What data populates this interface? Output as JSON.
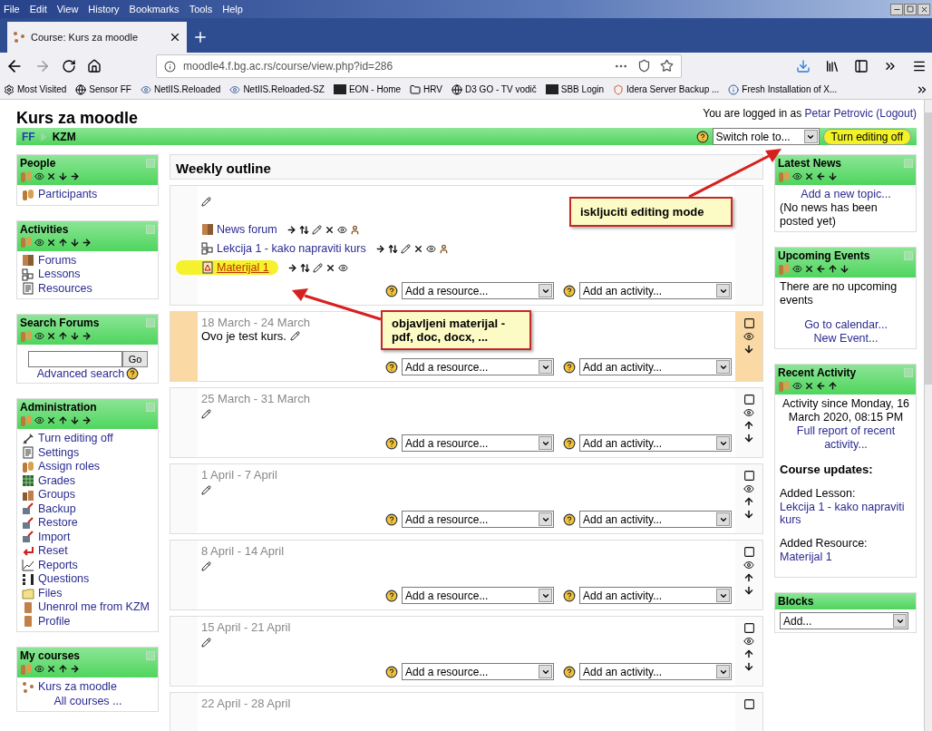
{
  "browser": {
    "menu": [
      "File",
      "Edit",
      "View",
      "History",
      "Bookmarks",
      "Tools",
      "Help"
    ],
    "tabs": [
      {
        "title": "Course: Kurs za moodle",
        "selected": true
      }
    ],
    "url": "moodle4.f.bg.ac.rs/course/view.php?id=286",
    "bookmarks": [
      {
        "label": "Most Visited",
        "kind": "gear"
      },
      {
        "label": "Sensor FF",
        "kind": "globe"
      },
      {
        "label": "NetIIS.Reloaded",
        "kind": "eye"
      },
      {
        "label": "NetIIS.Reloaded-SZ",
        "kind": "eye"
      },
      {
        "label": "EON - Home",
        "kind": "box"
      },
      {
        "label": "HRV",
        "kind": "folder"
      },
      {
        "label": "D3 GO - TV vodič",
        "kind": "globe"
      },
      {
        "label": "SBB Login",
        "kind": "box"
      },
      {
        "label": "Idera Server Backup ...",
        "kind": "shield"
      },
      {
        "label": "Fresh Installation of X...",
        "kind": "info"
      }
    ]
  },
  "page": {
    "title": "Kurs za moodle",
    "login": {
      "text": "You are logged in as",
      "user": "Petar Petrovic",
      "logout": "(Logout)"
    },
    "breadcrumb": [
      "FF",
      "KZM"
    ],
    "role_select": "Switch role to...",
    "edit_button": "Turn editing off"
  },
  "left_blocks": [
    {
      "title": "People",
      "collapsible": true,
      "controls": [
        {
          "kind": "role"
        },
        {
          "kind": "hide"
        },
        {
          "kind": "delete"
        },
        {
          "kind": "down"
        },
        {
          "kind": "right"
        }
      ],
      "lines": [
        {
          "kind": "role",
          "text": "Participants"
        }
      ]
    },
    {
      "title": "Activities",
      "collapsible": true,
      "controls": [
        {
          "kind": "role"
        },
        {
          "kind": "hide"
        },
        {
          "kind": "delete"
        },
        {
          "kind": "up"
        },
        {
          "kind": "down"
        },
        {
          "kind": "right"
        }
      ],
      "lines": [
        {
          "kind": "forum",
          "text": "Forums"
        },
        {
          "kind": "lesson",
          "text": "Lessons"
        },
        {
          "kind": "resource",
          "text": "Resources"
        }
      ]
    },
    {
      "title": "Search Forums",
      "collapsible": true,
      "controls": [
        {
          "kind": "role"
        },
        {
          "kind": "hide"
        },
        {
          "kind": "delete"
        },
        {
          "kind": "up"
        },
        {
          "kind": "down"
        },
        {
          "kind": "right"
        }
      ],
      "lines": [
        {
          "kind": "search",
          "text": "Go"
        },
        {
          "kind": "help-link",
          "text": "Advanced search"
        }
      ]
    },
    {
      "title": "Administration",
      "collapsible": true,
      "controls": [
        {
          "kind": "role"
        },
        {
          "kind": "hide"
        },
        {
          "kind": "delete"
        },
        {
          "kind": "up"
        },
        {
          "kind": "down"
        },
        {
          "kind": "right"
        }
      ],
      "lines": [
        {
          "kind": "edit",
          "text": "Turn editing off"
        },
        {
          "kind": "resource",
          "text": "Settings"
        },
        {
          "kind": "role",
          "text": "Assign roles"
        },
        {
          "kind": "grades",
          "text": "Grades"
        },
        {
          "kind": "groups",
          "text": "Groups"
        },
        {
          "kind": "backup",
          "text": "Backup"
        },
        {
          "kind": "backup",
          "text": "Restore"
        },
        {
          "kind": "backup",
          "text": "Import"
        },
        {
          "kind": "reset",
          "text": "Reset"
        },
        {
          "kind": "reports",
          "text": "Reports"
        },
        {
          "kind": "questions",
          "text": "Questions"
        },
        {
          "kind": "files",
          "text": "Files"
        },
        {
          "kind": "person",
          "text": "Unenrol me from KZM"
        },
        {
          "kind": "person",
          "text": "Profile"
        }
      ]
    },
    {
      "title": "My courses",
      "collapsible": true,
      "controls": [
        {
          "kind": "role"
        },
        {
          "kind": "hide"
        },
        {
          "kind": "delete"
        },
        {
          "kind": "up"
        },
        {
          "kind": "right"
        }
      ],
      "lines": [
        {
          "kind": "course",
          "text": "Kurs za moodle"
        },
        {
          "kind": "center-link",
          "text": "All courses ..."
        }
      ]
    }
  ],
  "outline": {
    "title": "Weekly outline",
    "sections": [
      {
        "current": false,
        "edit": true,
        "items": [
          {
            "kind": "forum",
            "name": "News forum",
            "marked": false,
            "controls": [
              {
                "kind": "move"
              },
              {
                "kind": "updown"
              },
              {
                "kind": "edit"
              },
              {
                "kind": "delete"
              },
              {
                "kind": "hide"
              },
              {
                "kind": "group"
              }
            ]
          },
          {
            "kind": "lesson",
            "name": "Lekcija 1 - kako napraviti kurs",
            "marked": false,
            "controls": [
              {
                "kind": "move"
              },
              {
                "kind": "updown"
              },
              {
                "kind": "edit"
              },
              {
                "kind": "delete"
              },
              {
                "kind": "hide"
              },
              {
                "kind": "group"
              }
            ]
          },
          {
            "kind": "pdf",
            "name": "Materijal 1",
            "marked": true,
            "controls": [
              {
                "kind": "move"
              },
              {
                "kind": "updown"
              },
              {
                "kind": "edit"
              },
              {
                "kind": "delete"
              },
              {
                "kind": "hide"
              }
            ]
          }
        ],
        "selects": [
          "Add a resource...",
          "Add an activity..."
        ]
      },
      {
        "dates": "18 March - 24 March",
        "summary": "Ovo je test kurs.",
        "current": true,
        "edit": true,
        "selects": [
          "Add a resource...",
          "Add an activity..."
        ],
        "controls": [
          {
            "kind": "highlight"
          },
          {
            "kind": "hide"
          },
          {
            "kind": "down"
          }
        ]
      },
      {
        "dates": "25 March - 31 March",
        "current": false,
        "edit": true,
        "selects": [
          "Add a resource...",
          "Add an activity..."
        ],
        "controls": [
          {
            "kind": "highlight"
          },
          {
            "kind": "hide"
          },
          {
            "kind": "up"
          },
          {
            "kind": "down"
          }
        ]
      },
      {
        "dates": "1 April - 7 April",
        "current": false,
        "edit": true,
        "selects": [
          "Add a resource...",
          "Add an activity..."
        ],
        "controls": [
          {
            "kind": "highlight"
          },
          {
            "kind": "hide"
          },
          {
            "kind": "up"
          },
          {
            "kind": "down"
          }
        ]
      },
      {
        "dates": "8 April - 14 April",
        "current": false,
        "edit": true,
        "selects": [
          "Add a resource...",
          "Add an activity..."
        ],
        "controls": [
          {
            "kind": "highlight"
          },
          {
            "kind": "hide"
          },
          {
            "kind": "up"
          },
          {
            "kind": "down"
          }
        ]
      },
      {
        "dates": "15 April - 21 April",
        "current": false,
        "edit": true,
        "selects": [
          "Add a resource...",
          "Add an activity..."
        ],
        "controls": [
          {
            "kind": "highlight"
          },
          {
            "kind": "hide"
          },
          {
            "kind": "up"
          },
          {
            "kind": "down"
          }
        ]
      },
      {
        "dates": "22 April - 28 April",
        "current": false,
        "edit": false,
        "controls": [
          {
            "kind": "highlight"
          }
        ]
      }
    ]
  },
  "right_blocks": [
    {
      "title": "Latest News",
      "collapsible": true,
      "controls": [
        {
          "kind": "role"
        },
        {
          "kind": "hide"
        },
        {
          "kind": "delete"
        },
        {
          "kind": "left"
        },
        {
          "kind": "down"
        }
      ],
      "lines": [
        {
          "kind": "center-link",
          "text": "Add a new topic..."
        },
        {
          "kind": "text",
          "text": "(No news has been posted yet)"
        }
      ]
    },
    {
      "title": "Upcoming Events",
      "collapsible": true,
      "controls": [
        {
          "kind": "role"
        },
        {
          "kind": "hide"
        },
        {
          "kind": "delete"
        },
        {
          "kind": "left"
        },
        {
          "kind": "up"
        },
        {
          "kind": "down"
        }
      ],
      "lines": [
        {
          "kind": "text",
          "text": "There are no upcoming events"
        },
        {
          "kind": "spacer"
        },
        {
          "kind": "center-link",
          "text": "Go to calendar..."
        },
        {
          "kind": "center-link",
          "text": "New Event..."
        }
      ]
    },
    {
      "title": "Recent Activity",
      "collapsible": true,
      "controls": [
        {
          "kind": "role"
        },
        {
          "kind": "hide"
        },
        {
          "kind": "delete"
        },
        {
          "kind": "left"
        },
        {
          "kind": "up"
        }
      ],
      "lines": [
        {
          "kind": "center-text",
          "text": "Activity since Monday, 16 March 2020, 08:15 PM"
        },
        {
          "kind": "center-link",
          "text": "Full report of recent activity..."
        },
        {
          "kind": "spacer"
        },
        {
          "kind": "heading",
          "text": "Course updates:"
        },
        {
          "kind": "spacer"
        },
        {
          "kind": "text",
          "text": "Added Lesson:"
        },
        {
          "kind": "link",
          "text": "Lekcija 1 - kako napraviti kurs"
        },
        {
          "kind": "spacer"
        },
        {
          "kind": "text",
          "text": "Added Resource:"
        },
        {
          "kind": "link",
          "text": "Materijal 1"
        },
        {
          "kind": "spacer"
        }
      ]
    },
    {
      "title": "Blocks",
      "collapsible": false,
      "lines": [
        {
          "kind": "select",
          "text": "Add..."
        }
      ]
    }
  ],
  "annotations": [
    {
      "text": "iskljuciti editing mode"
    },
    {
      "text": "objavljeni materijal - pdf, doc, docx, ..."
    }
  ]
}
